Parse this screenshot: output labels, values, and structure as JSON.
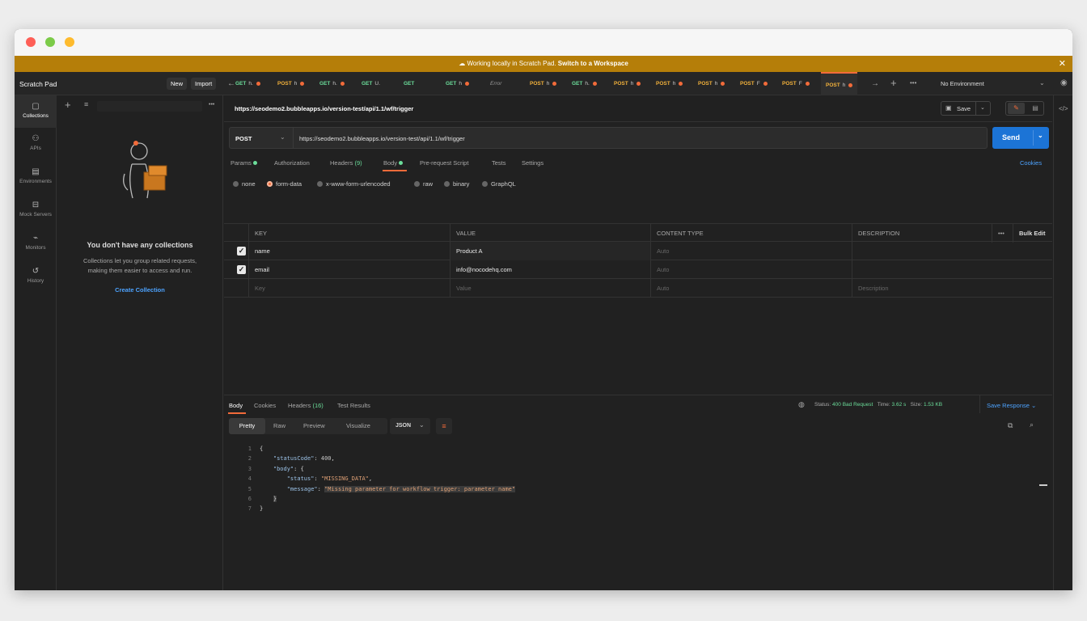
{
  "banner": {
    "text": "Working locally in Scratch Pad.",
    "link": "Switch to a Workspace"
  },
  "header": {
    "title": "Scratch Pad",
    "new_label": "New",
    "import_label": "Import",
    "environment": "No Environment"
  },
  "tabs": [
    {
      "method": "GET",
      "label": "h.",
      "dot": true
    },
    {
      "method": "POST",
      "label": "h",
      "dot": true
    },
    {
      "method": "GET",
      "label": "h.",
      "dot": true
    },
    {
      "method": "GET",
      "label": "U.",
      "dot": false
    },
    {
      "method": "GET",
      "label": "",
      "dot": false
    },
    {
      "method": "GET",
      "label": "h",
      "dot": true
    },
    {
      "method": "",
      "label": "Error",
      "dot": false
    },
    {
      "method": "POST",
      "label": "h",
      "dot": true
    },
    {
      "method": "GET",
      "label": "h.",
      "dot": true
    },
    {
      "method": "POST",
      "label": "h",
      "dot": true
    },
    {
      "method": "POST",
      "label": "h",
      "dot": true
    },
    {
      "method": "POST",
      "label": "h",
      "dot": true
    },
    {
      "method": "POST",
      "label": "F",
      "dot": true
    },
    {
      "method": "POST",
      "label": "F",
      "dot": true
    },
    {
      "method": "POST",
      "label": "h",
      "dot": true
    }
  ],
  "sidebar": {
    "items": [
      "Collections",
      "APIs",
      "Environments",
      "Mock Servers",
      "Monitors",
      "History"
    ],
    "empty_title": "You don't have any collections",
    "empty_desc_1": "Collections let you group related requests,",
    "empty_desc_2": "making them easier to access and run.",
    "create_label": "Create Collection"
  },
  "request": {
    "name": "https://seodemo2.bubbleapps.io/version-test/api/1.1/wf/trigger",
    "save_label": "Save",
    "method": "POST",
    "url": "https://seodemo2.bubbleapps.io/version-test/api/1.1/wf/trigger",
    "send_label": "Send",
    "tabs": {
      "params": "Params",
      "authorization": "Authorization",
      "headers": "Headers",
      "headers_count": "(9)",
      "body": "Body",
      "prerequest": "Pre-request Script",
      "tests": "Tests",
      "settings": "Settings",
      "cookies": "Cookies"
    },
    "body_types": [
      "none",
      "form-data",
      "x-www-form-urlencoded",
      "raw",
      "binary",
      "GraphQL"
    ]
  },
  "table": {
    "headers": {
      "key": "KEY",
      "value": "VALUE",
      "content_type": "CONTENT TYPE",
      "description": "DESCRIPTION",
      "bulk_edit": "Bulk Edit"
    },
    "rows": [
      {
        "key": "name",
        "value": "Product A",
        "content_type": "Auto"
      },
      {
        "key": "email",
        "value": "info@nocodehq.com",
        "content_type": "Auto"
      }
    ],
    "placeholder": {
      "key": "Key",
      "value": "Value",
      "content_type": "Auto",
      "description": "Description"
    }
  },
  "response": {
    "tabs": {
      "body": "Body",
      "cookies": "Cookies",
      "headers": "Headers",
      "headers_count": "(16)",
      "tests": "Test Results"
    },
    "status_label": "Status:",
    "status": "400 Bad Request",
    "time_label": "Time:",
    "time": "3.62 s",
    "size_label": "Size:",
    "size": "1.53 KB",
    "save_label": "Save Response",
    "views": {
      "pretty": "Pretty",
      "raw": "Raw",
      "preview": "Preview",
      "visualize": "Visualize",
      "format": "JSON"
    },
    "code": {
      "l1": "{",
      "k_status_code": "\"statusCode\"",
      "v_status_code": "400",
      "k_body": "\"body\"",
      "k_status": "\"status\"",
      "v_status": "\"MISSING_DATA\"",
      "k_message": "\"message\"",
      "v_message": "\"Missing parameter for workflow trigger: parameter name\"",
      "l6": "}",
      "l7": "}"
    }
  },
  "colors": {
    "accent": "#f26b3a",
    "send": "#1c74d6",
    "banner": "#b57e09",
    "success": "#6bdd9a"
  }
}
